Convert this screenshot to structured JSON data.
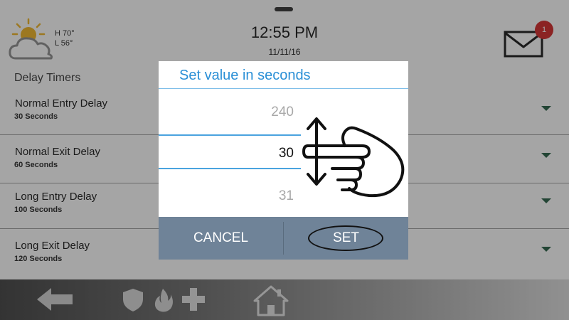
{
  "header": {
    "time": "12:55 PM",
    "date": "11/11/16",
    "weather": {
      "high": "H 70°",
      "low": "L 56°",
      "icon": "partly-cloudy-icon"
    },
    "mail": {
      "icon": "mail-icon",
      "badge_count": "1",
      "badge_color": "#d21f1f"
    }
  },
  "section": {
    "title": "Delay Timers"
  },
  "timers": [
    {
      "title": "Normal Entry Delay",
      "value": "30 Seconds"
    },
    {
      "title": "Normal Exit Delay",
      "value": "60 Seconds"
    },
    {
      "title": "Long Entry Delay",
      "value": "100 Seconds"
    },
    {
      "title": "Long Exit Delay",
      "value": "120 Seconds"
    }
  ],
  "bottom_bar": {
    "icons": [
      "back-arrow-icon",
      "shield-icon",
      "fire-icon",
      "medical-cross-icon",
      "home-icon"
    ]
  },
  "dialog": {
    "title": "Set value in seconds",
    "picker": {
      "above": "240",
      "selected": "30",
      "below": "31"
    },
    "cancel_label": "CANCEL",
    "set_label": "SET",
    "accent_color": "#2a8fd6",
    "action_bar_color": "#6f8398"
  }
}
